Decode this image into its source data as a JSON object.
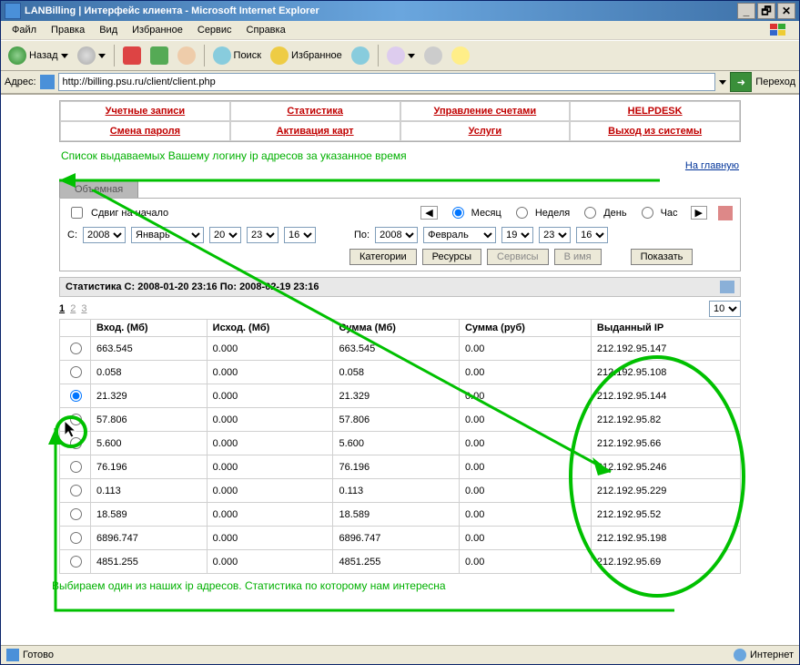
{
  "window": {
    "title": "LANBilling | Интерфейс клиента - Microsoft Internet Explorer",
    "min": "_",
    "max": "❐",
    "restore": "🗗",
    "close": "✕"
  },
  "menubar": [
    "Файл",
    "Правка",
    "Вид",
    "Избранное",
    "Сервис",
    "Справка"
  ],
  "toolbar": {
    "back": "Назад",
    "search": "Поиск",
    "favorites": "Избранное"
  },
  "addressbar": {
    "label": "Адрес:",
    "url": "http://billing.psu.ru/client/client.php",
    "go": "Переход"
  },
  "nav": {
    "r1": [
      "Учетные записи",
      "Статистика",
      "Управление счетами",
      "HELPDESK"
    ],
    "r2": [
      "Смена пароля",
      "Активация карт",
      "Услуги",
      "Выход из системы"
    ]
  },
  "annotation_top": "Список выдаваемых Вашему логину ip адресов за указанное время",
  "main_link": "На главную",
  "tab_label": "Объемная",
  "panel": {
    "shift_label": "Сдвиг на начало",
    "period": {
      "month": "Месяц",
      "week": "Неделя",
      "day": "День",
      "hour": "Час"
    },
    "from_label": "С:",
    "to_label": "По:",
    "from": {
      "year": "2008",
      "month": "Январь",
      "day": "20",
      "hour": "23",
      "min": "16"
    },
    "to": {
      "year": "2008",
      "month": "Февраль",
      "day": "19",
      "hour": "23",
      "min": "16"
    },
    "buttons": {
      "cat": "Категории",
      "res": "Ресурсы",
      "srv": "Сервисы",
      "name": "В имя",
      "show": "Показать"
    }
  },
  "stat_title": "Статистика С: 2008-01-20 23:16 По: 2008-02-19 23:16",
  "pager": {
    "pages": [
      "1",
      "2",
      "3"
    ],
    "size": "10"
  },
  "table": {
    "headers": [
      "Вход. (Мб)",
      "Исход. (Мб)",
      "Сумма (Мб)",
      "Сумма (руб)",
      "Выданный IP"
    ],
    "rows": [
      {
        "in": "663.545",
        "out": "0.000",
        "sum": "663.545",
        "rub": "0.00",
        "ip": "212.192.95.147"
      },
      {
        "in": "0.058",
        "out": "0.000",
        "sum": "0.058",
        "rub": "0.00",
        "ip": "212.192.95.108"
      },
      {
        "in": "21.329",
        "out": "0.000",
        "sum": "21.329",
        "rub": "0.00",
        "ip": "212.192.95.144"
      },
      {
        "in": "57.806",
        "out": "0.000",
        "sum": "57.806",
        "rub": "0.00",
        "ip": "212.192.95.82"
      },
      {
        "in": "5.600",
        "out": "0.000",
        "sum": "5.600",
        "rub": "0.00",
        "ip": "212.192.95.66"
      },
      {
        "in": "76.196",
        "out": "0.000",
        "sum": "76.196",
        "rub": "0.00",
        "ip": "212.192.95.246"
      },
      {
        "in": "0.113",
        "out": "0.000",
        "sum": "0.113",
        "rub": "0.00",
        "ip": "212.192.95.229"
      },
      {
        "in": "18.589",
        "out": "0.000",
        "sum": "18.589",
        "rub": "0.00",
        "ip": "212.192.95.52"
      },
      {
        "in": "6896.747",
        "out": "0.000",
        "sum": "6896.747",
        "rub": "0.00",
        "ip": "212.192.95.198"
      },
      {
        "in": "4851.255",
        "out": "0.000",
        "sum": "4851.255",
        "rub": "0.00",
        "ip": "212.192.95.69"
      }
    ]
  },
  "annotation_bottom": "Выбираем один из наших ip адресов. Статистика по которому нам интересна",
  "status": {
    "ready": "Готово",
    "zone": "Интернет"
  }
}
